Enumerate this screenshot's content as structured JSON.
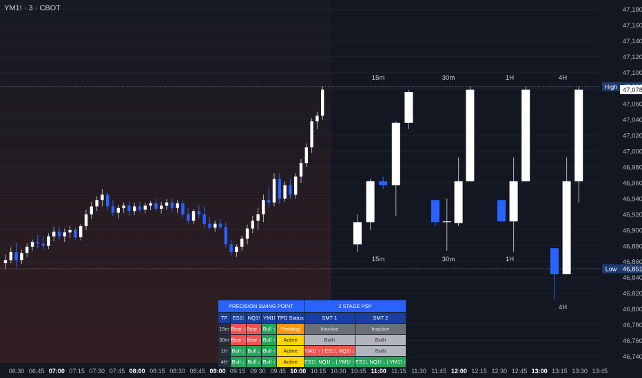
{
  "header": {
    "symbol": "YM1! · 3 · CBOT"
  },
  "colors": {
    "bull": "#ffffff",
    "bear": "#2962ff",
    "wick": "#b2b5be",
    "axis_text": "#b2b5be",
    "grid": "#2a2e39",
    "level_box": "#1e3a6e",
    "table_header": "#2962ff"
  },
  "chart_data": {
    "type": "candlestick",
    "y_axis": {
      "ylim": [
        46725,
        47185
      ],
      "ticks": [
        47180,
        47160,
        47140,
        47120,
        47100,
        47080,
        47060,
        47040,
        47020,
        47000,
        46980,
        46960,
        46940,
        46920,
        46900,
        46880,
        46860,
        46840,
        46820,
        46800,
        46780,
        46760,
        46740
      ]
    },
    "time_axis": [
      "06:30",
      "06:45",
      "07:00",
      "07:15",
      "07:30",
      "07:45",
      "08:00",
      "08:15",
      "08:30",
      "08:45",
      "09:00",
      "09:15",
      "09:30",
      "09:45",
      "10:00",
      "10:15",
      "10:30",
      "10:45",
      "11:00",
      "11:15",
      "11:30",
      "11:45",
      "12:00",
      "12:15",
      "12:30",
      "12:45",
      "13:00",
      "13:15",
      "13:30",
      "13:45"
    ],
    "bold_times": [
      "07:00",
      "08:00",
      "09:00",
      "10:00",
      "11:00",
      "12:00",
      "13:00"
    ],
    "levels": [
      {
        "name": "High",
        "price": 47082
      },
      {
        "name": "Low",
        "price": 46851
      }
    ],
    "last_price": 47078,
    "series": [
      {
        "name": "YM1! 3m",
        "ohlc": [
          [
            46858,
            46869,
            46850,
            46862
          ],
          [
            46862,
            46878,
            46858,
            46872
          ],
          [
            46872,
            46884,
            46853,
            46862
          ],
          [
            46862,
            46875,
            46857,
            46871
          ],
          [
            46871,
            46883,
            46866,
            46879
          ],
          [
            46879,
            46888,
            46874,
            46885
          ],
          [
            46885,
            46894,
            46877,
            46883
          ],
          [
            46883,
            46892,
            46875,
            46880
          ],
          [
            46880,
            46896,
            46876,
            46892
          ],
          [
            46892,
            46904,
            46886,
            46898
          ],
          [
            46898,
            46905,
            46888,
            46892
          ],
          [
            46892,
            46902,
            46885,
            46897
          ],
          [
            46897,
            46905,
            46890,
            46900
          ],
          [
            46900,
            46903,
            46888,
            46891
          ],
          [
            46891,
            46908,
            46887,
            46905
          ],
          [
            46905,
            46926,
            46900,
            46920
          ],
          [
            46920,
            46936,
            46914,
            46930
          ],
          [
            46930,
            46943,
            46924,
            46938
          ],
          [
            46938,
            46952,
            46930,
            46945
          ],
          [
            46945,
            46948,
            46926,
            46930
          ],
          [
            46930,
            46938,
            46918,
            46922
          ],
          [
            46922,
            46932,
            46915,
            46928
          ],
          [
            46928,
            46935,
            46922,
            46931
          ],
          [
            46931,
            46936,
            46918,
            46924
          ],
          [
            46924,
            46935,
            46919,
            46930
          ],
          [
            46930,
            46936,
            46922,
            46926
          ],
          [
            46926,
            46935,
            46921,
            46931
          ],
          [
            46931,
            46937,
            46925,
            46934
          ],
          [
            46934,
            46939,
            46923,
            46927
          ],
          [
            46927,
            46936,
            46921,
            46931
          ],
          [
            46931,
            46939,
            46926,
            46935
          ],
          [
            46935,
            46940,
            46924,
            46928
          ],
          [
            46928,
            46938,
            46922,
            46934
          ],
          [
            46934,
            46938,
            46916,
            46920
          ],
          [
            46920,
            46928,
            46908,
            46912
          ],
          [
            46912,
            46927,
            46908,
            46924
          ],
          [
            46924,
            46932,
            46915,
            46920
          ],
          [
            46920,
            46930,
            46904,
            46908
          ],
          [
            46908,
            46916,
            46900,
            46903
          ],
          [
            46903,
            46912,
            46898,
            46908
          ],
          [
            46908,
            46914,
            46901,
            46904
          ],
          [
            46904,
            46910,
            46878,
            46882
          ],
          [
            46882,
            46888,
            46868,
            46872
          ],
          [
            46872,
            46882,
            46866,
            46879
          ],
          [
            46879,
            46893,
            46874,
            46889
          ],
          [
            46889,
            46907,
            46882,
            46902
          ],
          [
            46902,
            46918,
            46896,
            46912
          ],
          [
            46912,
            46928,
            46900,
            46920
          ],
          [
            46920,
            46945,
            46910,
            46938
          ],
          [
            46938,
            46955,
            46928,
            46935
          ],
          [
            46935,
            46972,
            46930,
            46965
          ],
          [
            46965,
            46972,
            46934,
            46940
          ],
          [
            46940,
            46962,
            46936,
            46957
          ],
          [
            46957,
            46965,
            46940,
            46945
          ],
          [
            46945,
            46972,
            46940,
            46968
          ],
          [
            46968,
            46990,
            46960,
            46985
          ],
          [
            46985,
            47010,
            46980,
            47005
          ],
          [
            47005,
            47042,
            46998,
            47038
          ],
          [
            47038,
            47050,
            47028,
            47045
          ],
          [
            47045,
            47082,
            47040,
            47078
          ]
        ]
      },
      {
        "name": "15m",
        "ohlc": [
          [
            46882,
            46920,
            46872,
            46910
          ],
          [
            46910,
            46965,
            46900,
            46962
          ],
          [
            46962,
            46968,
            46952,
            46957
          ],
          [
            46957,
            47038,
            46918,
            47036
          ],
          [
            47036,
            47078,
            47028,
            47075
          ]
        ]
      },
      {
        "name": "30m",
        "ohlc": [
          [
            46938,
            46938,
            46905,
            46910
          ],
          [
            46910,
            46940,
            46874,
            46911
          ],
          [
            46909,
            46992,
            46905,
            46962
          ],
          [
            46962,
            47082,
            46962,
            47078
          ]
        ]
      },
      {
        "name": "1H",
        "ohlc": [
          [
            46938,
            46938,
            46910,
            46911
          ],
          [
            46911,
            46992,
            46872,
            46962
          ],
          [
            46962,
            47082,
            46962,
            47078
          ]
        ]
      },
      {
        "name": "4H",
        "ohlc": [
          [
            46877,
            46877,
            46812,
            46844
          ],
          [
            46844,
            46992,
            46844,
            46962
          ],
          [
            46962,
            47082,
            46935,
            47078
          ]
        ]
      }
    ],
    "labels": [
      {
        "text": "15m",
        "position": "top"
      },
      {
        "text": "30m",
        "position": "top"
      },
      {
        "text": "1H",
        "position": "top"
      },
      {
        "text": "4H",
        "position": "top"
      },
      {
        "text": "15m",
        "position": "bottom"
      },
      {
        "text": "30m",
        "position": "bottom"
      },
      {
        "text": "1H",
        "position": "bottom"
      },
      {
        "text": "4H",
        "position": "bottom"
      }
    ]
  },
  "table": {
    "header_left": "PRECISION SWING POINT",
    "header_right": "2 STAGE PSP",
    "columns": [
      "TF",
      "ES1!",
      "NQ1!",
      "YM1!",
      "TPD Status",
      "SMT 1",
      "SMT 2"
    ],
    "rows": [
      [
        "15m",
        "Bear ↓",
        "Bear ↓",
        "Bull ↑",
        "Pending",
        "Inactive",
        "Inactive"
      ],
      [
        "30m",
        "Bear ↓",
        "Bear ↓",
        "Bull ↑",
        "Active",
        "Both",
        "Both"
      ],
      [
        "1H",
        "Bull ↓",
        "Bull ↓",
        "Bull ↑",
        "Active",
        "YM1! ↑ | ES1!, NQ1! ↓",
        "Both"
      ],
      [
        "4H",
        "Bull ↓",
        "Bull ↓",
        "Bull ↑",
        "Active",
        "ES1!, NQ1! ↓ | YM1! ↑",
        "ES1!, NQ1! ↓ | YM1! ↑"
      ]
    ]
  }
}
